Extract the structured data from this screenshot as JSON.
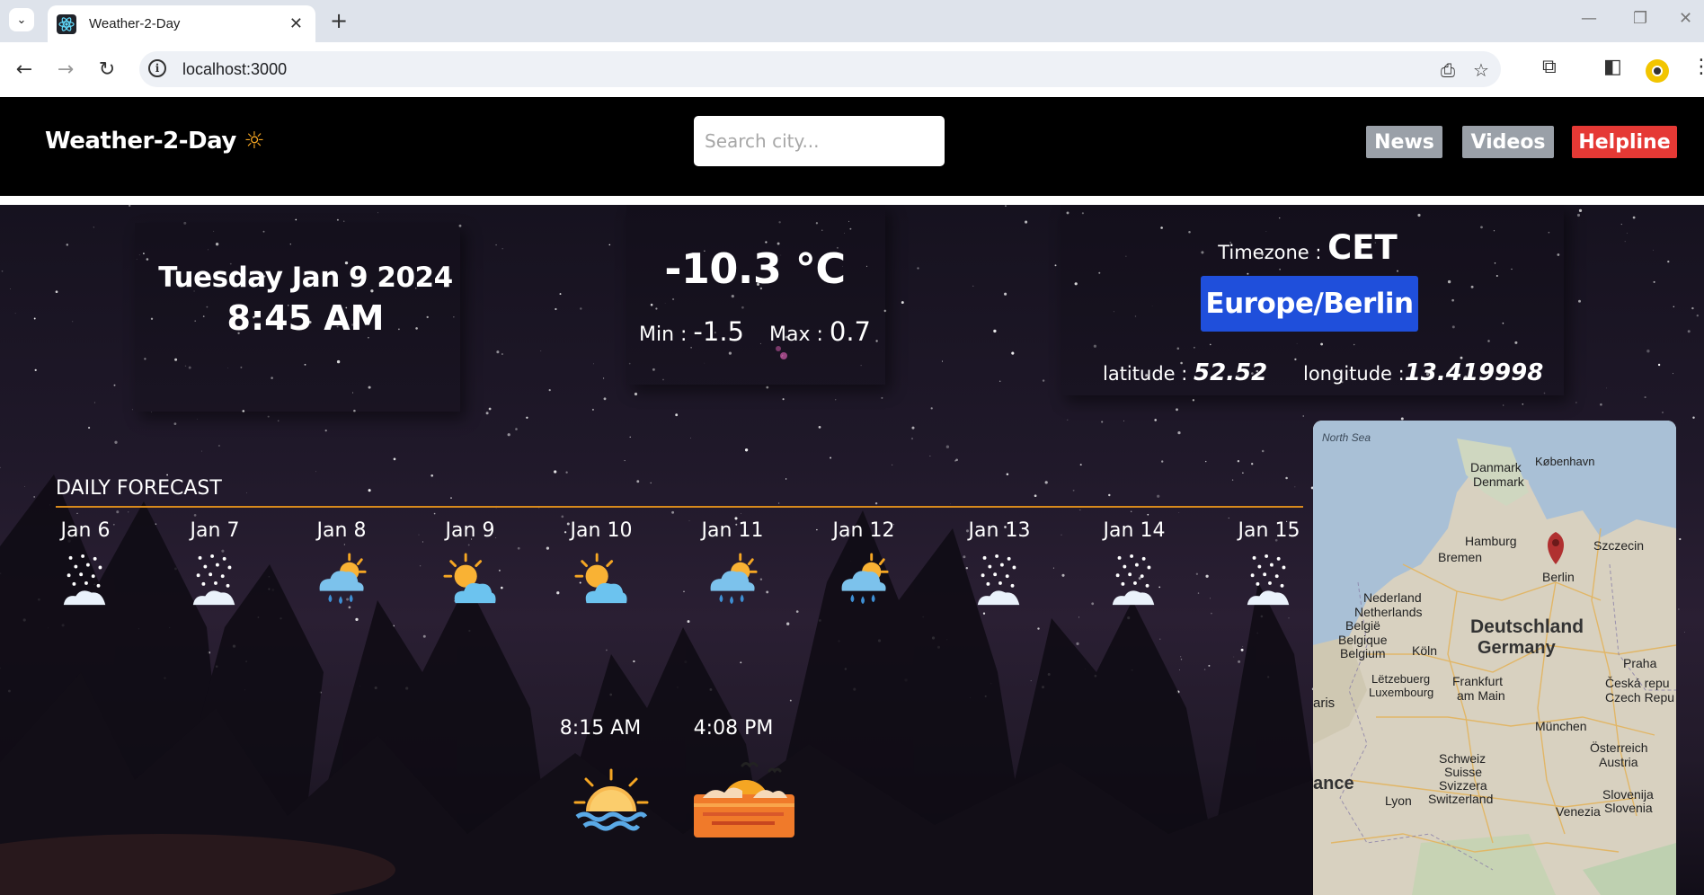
{
  "browser": {
    "tab_title": "Weather-2-Day",
    "tab_close": "✕",
    "new_tab": "+",
    "url": "localhost:3000"
  },
  "header": {
    "brand": "Weather-2-Day",
    "brand_icon": "☼",
    "search_placeholder": "Search city...",
    "buttons": [
      {
        "label": "News",
        "color": "#9aa0a8"
      },
      {
        "label": "Videos",
        "color": "#9aa0a8"
      },
      {
        "label": "Helpline",
        "color": "#e53935"
      }
    ]
  },
  "current": {
    "date": "Tuesday Jan 9 2024",
    "time": "8:45 AM",
    "temperature": "-10.3 °C",
    "min_label": "Min : ",
    "min_value": "-1.5",
    "max_label": "Max : ",
    "max_value": "0.7"
  },
  "location": {
    "timezone_label": "Timezone : ",
    "timezone_value": "CET",
    "region": "Europe/Berlin",
    "latitude_label": "latitude : ",
    "latitude_value": "52.52",
    "longitude_label": "longitude :",
    "longitude_value": "13.419998"
  },
  "forecast": {
    "heading": "DAILY FORECAST",
    "days": [
      {
        "label": "Jan 6",
        "icon": "snow-icon"
      },
      {
        "label": "Jan 7",
        "icon": "snow-icon"
      },
      {
        "label": "Jan 8",
        "icon": "sun-rain-cloud-icon"
      },
      {
        "label": "Jan 9",
        "icon": "partly-cloudy-icon"
      },
      {
        "label": "Jan 10",
        "icon": "partly-cloudy-icon"
      },
      {
        "label": "Jan 11",
        "icon": "sun-rain-cloud-icon"
      },
      {
        "label": "Jan 12",
        "icon": "sun-rain-cloud-icon"
      },
      {
        "label": "Jan 13",
        "icon": "snow-icon"
      },
      {
        "label": "Jan 14",
        "icon": "snow-icon"
      },
      {
        "label": "Jan 15",
        "icon": "snow-icon"
      }
    ]
  },
  "sun": {
    "sunrise": "8:15 AM",
    "sunset": "4:08 PM"
  },
  "map": {
    "labels": {
      "north_sea": "North Sea",
      "kobenhavn": "København",
      "danmark": "Danmark",
      "denmark": "Denmark",
      "hamburg": "Hamburg",
      "szczecin": "Szczecin",
      "bremen": "Bremen",
      "berlin": "Berlin",
      "nederland": "Nederland",
      "netherlands": "Netherlands",
      "belgie": "België",
      "belgique": "Belgique",
      "belgium": "Belgium",
      "koln": "Köln",
      "deutschland": "Deutschland",
      "germany": "Germany",
      "praha": "Praha",
      "letzebuerg": "Lëtzebuerg",
      "luxembourg": "Luxembourg",
      "frankfurt": "Frankfurt",
      "am_main": "am Main",
      "ceska": "Česká repu",
      "czech": "Czech Repu",
      "aris": "aris",
      "munchen": "München",
      "osterreich": "Österreich",
      "austria": "Austria",
      "ance": "ance",
      "schweiz": "Schweiz",
      "suisse": "Suisse",
      "svizzera": "Svizzera",
      "switzerland": "Switzerland",
      "lyon": "Lyon",
      "slovenija": "Slovenija",
      "slovenia": "Slovenia",
      "venezia": "Venezia"
    }
  }
}
